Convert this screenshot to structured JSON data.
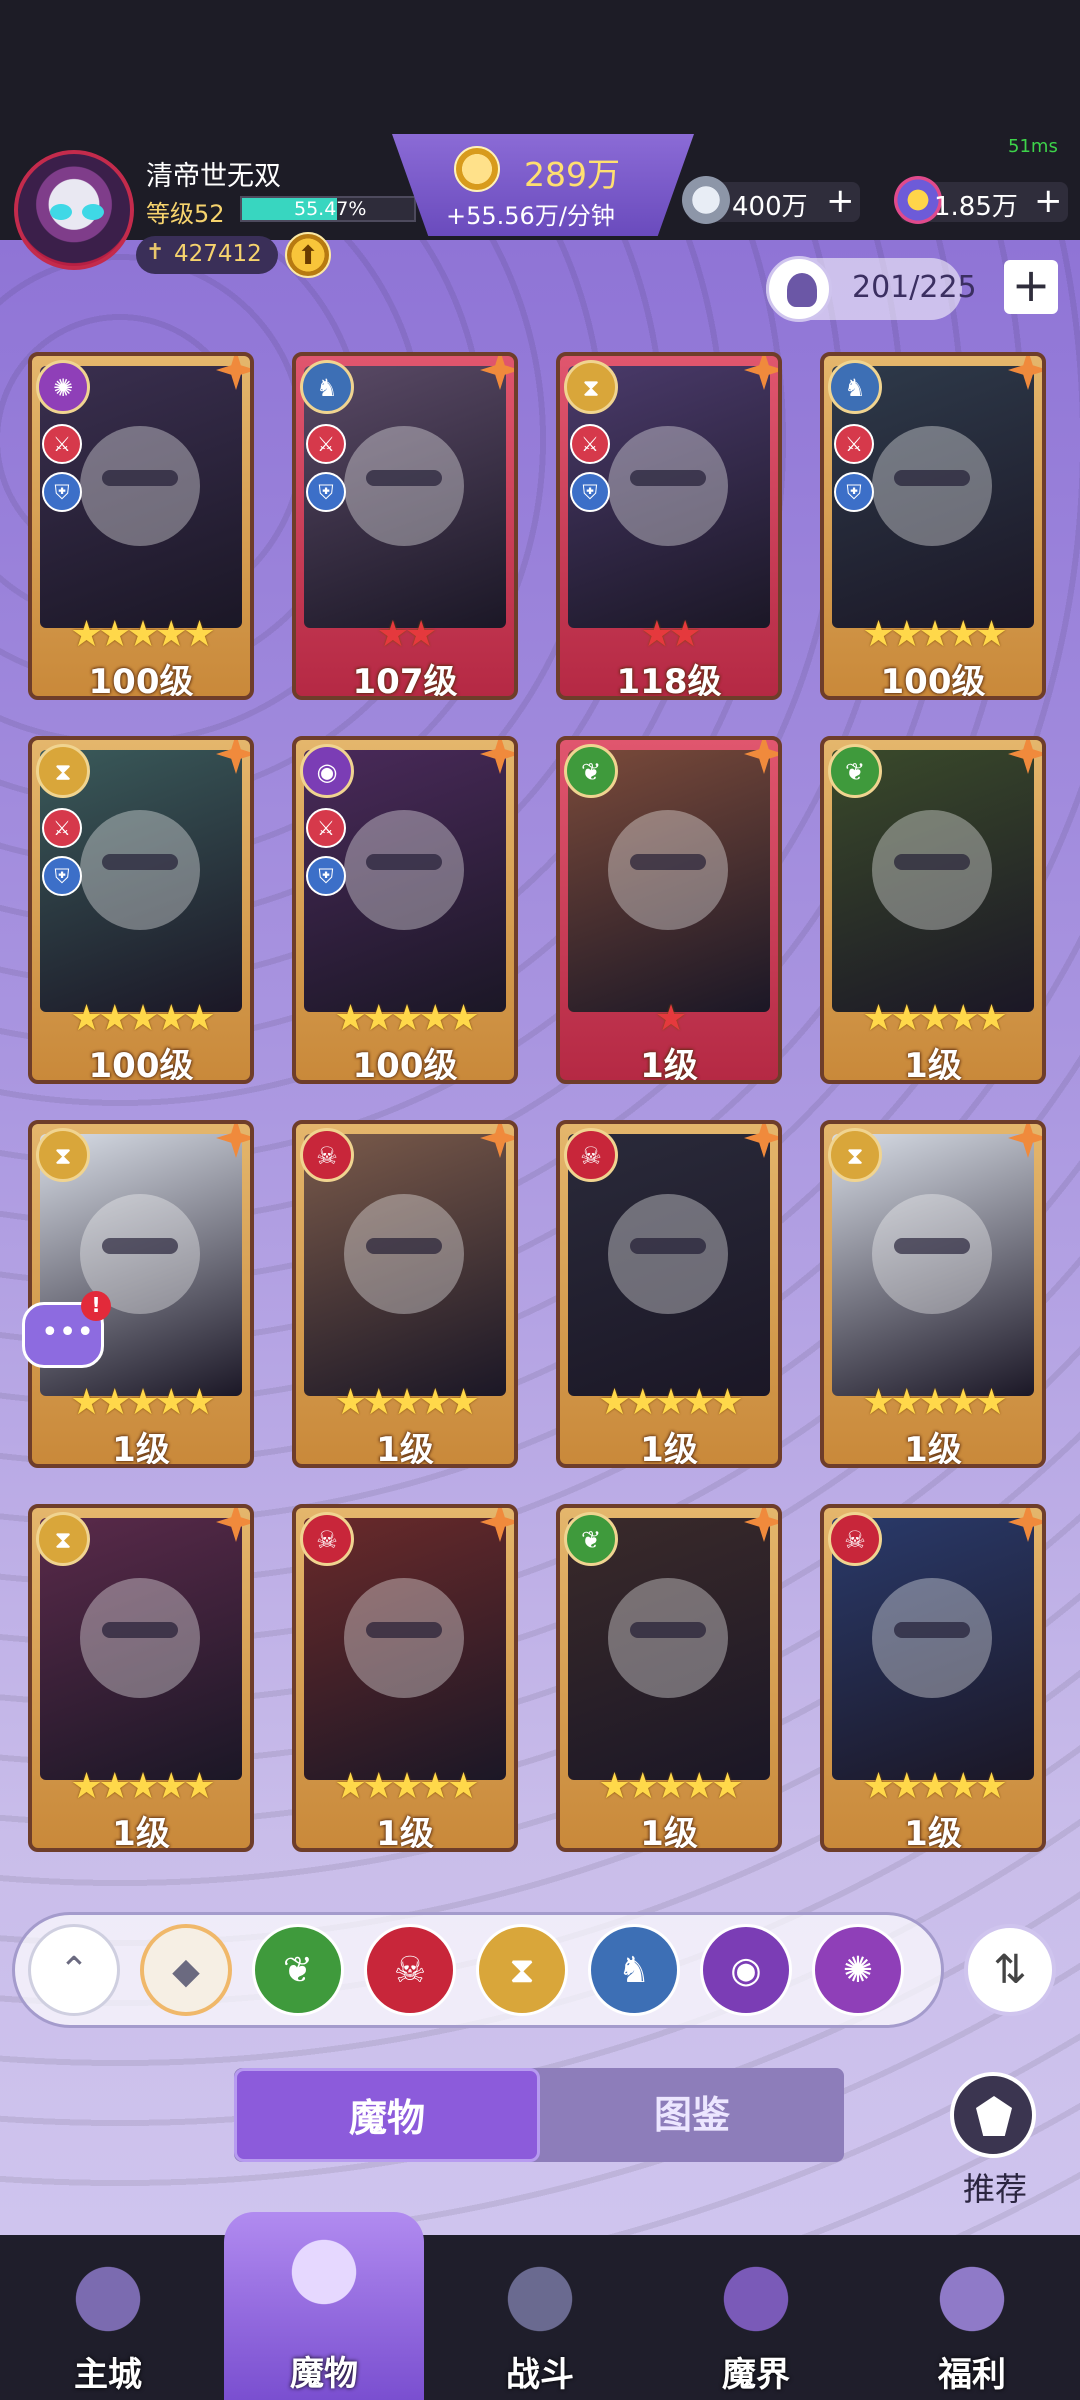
{
  "status": {
    "fps": "51ms"
  },
  "player": {
    "name": "清帝世无双",
    "level": "等级52",
    "exp_percent": "55.47%",
    "exp_fraction": 0.5547,
    "power": "427412"
  },
  "gold": {
    "amount": "289万",
    "rate": "+55.56万/分钟"
  },
  "resources": [
    {
      "icon": "gem-orb-icon",
      "value": "400万"
    },
    {
      "icon": "star-crystal-icon",
      "value": "1.85万"
    }
  ],
  "roster": {
    "capacity": "201/225"
  },
  "cards": [
    {
      "level": "100级",
      "stars": "★★★★★",
      "star_color": "gold",
      "rarity": "gold",
      "faction": "spiral",
      "badges": true
    },
    {
      "level": "107级",
      "stars": "★★",
      "star_color": "red",
      "rarity": "red",
      "faction": "dragon",
      "badges": true
    },
    {
      "level": "118级",
      "stars": "★★",
      "star_color": "red",
      "rarity": "red",
      "faction": "hourglass",
      "badges": true
    },
    {
      "level": "100级",
      "stars": "★★★★★",
      "star_color": "gold",
      "rarity": "gold",
      "faction": "dragon",
      "badges": true
    },
    {
      "level": "100级",
      "stars": "★★★★★",
      "star_color": "gold",
      "rarity": "gold",
      "faction": "hourglass",
      "badges": true
    },
    {
      "level": "100级",
      "stars": "★★★★★",
      "star_color": "gold",
      "rarity": "gold",
      "faction": "eye",
      "badges": true
    },
    {
      "level": "1级",
      "stars": "★",
      "star_color": "red",
      "rarity": "red",
      "faction": "leaf",
      "badges": false
    },
    {
      "level": "1级",
      "stars": "★★★★★",
      "star_color": "gold",
      "rarity": "gold",
      "faction": "leaf",
      "badges": false
    },
    {
      "level": "1级",
      "stars": "★★★★★",
      "star_color": "gold",
      "rarity": "gold",
      "faction": "hourglass",
      "badges": false
    },
    {
      "level": "1级",
      "stars": "★★★★★",
      "star_color": "gold",
      "rarity": "gold",
      "faction": "demon",
      "badges": false
    },
    {
      "level": "1级",
      "stars": "★★★★★",
      "star_color": "gold",
      "rarity": "gold",
      "faction": "demon",
      "badges": false
    },
    {
      "level": "1级",
      "stars": "★★★★★",
      "star_color": "gold",
      "rarity": "gold",
      "faction": "hourglass",
      "badges": false
    },
    {
      "level": "1级",
      "stars": "★★★★★",
      "star_color": "gold",
      "rarity": "gold",
      "faction": "hourglass",
      "badges": false
    },
    {
      "level": "1级",
      "stars": "★★★★★",
      "star_color": "gold",
      "rarity": "gold",
      "faction": "demon",
      "badges": false
    },
    {
      "level": "1级",
      "stars": "★★★★★",
      "star_color": "gold",
      "rarity": "gold",
      "faction": "leaf",
      "badges": false
    },
    {
      "level": "1级",
      "stars": "★★★★★",
      "star_color": "gold",
      "rarity": "gold",
      "faction": "demon",
      "badges": false
    }
  ],
  "filters": [
    {
      "name": "collapse-icon",
      "color": "#ffffff"
    },
    {
      "name": "all-factions-icon",
      "color": "#f6efe4"
    },
    {
      "name": "leaf-faction-icon",
      "color": "#3f9a3c"
    },
    {
      "name": "demon-faction-icon",
      "color": "#c8263a"
    },
    {
      "name": "hourglass-faction-icon",
      "color": "#d9a63a"
    },
    {
      "name": "dragon-faction-icon",
      "color": "#3d6fb5"
    },
    {
      "name": "eye-faction-icon",
      "color": "#7b3db5"
    },
    {
      "name": "spiral-faction-icon",
      "color": "#8f3fb8"
    }
  ],
  "chat": {
    "badge": "!"
  },
  "tabs": {
    "active": "魔物",
    "inactive": "图鉴"
  },
  "recommend": {
    "label": "推荐"
  },
  "nav": [
    {
      "label": "主城",
      "icon": "castle-icon"
    },
    {
      "label": "魔物",
      "icon": "monster-flame-icon"
    },
    {
      "label": "战斗",
      "icon": "battle-shield-icon"
    },
    {
      "label": "魔界",
      "icon": "portal-icon"
    },
    {
      "label": "福利",
      "icon": "treasure-chest-icon"
    }
  ]
}
